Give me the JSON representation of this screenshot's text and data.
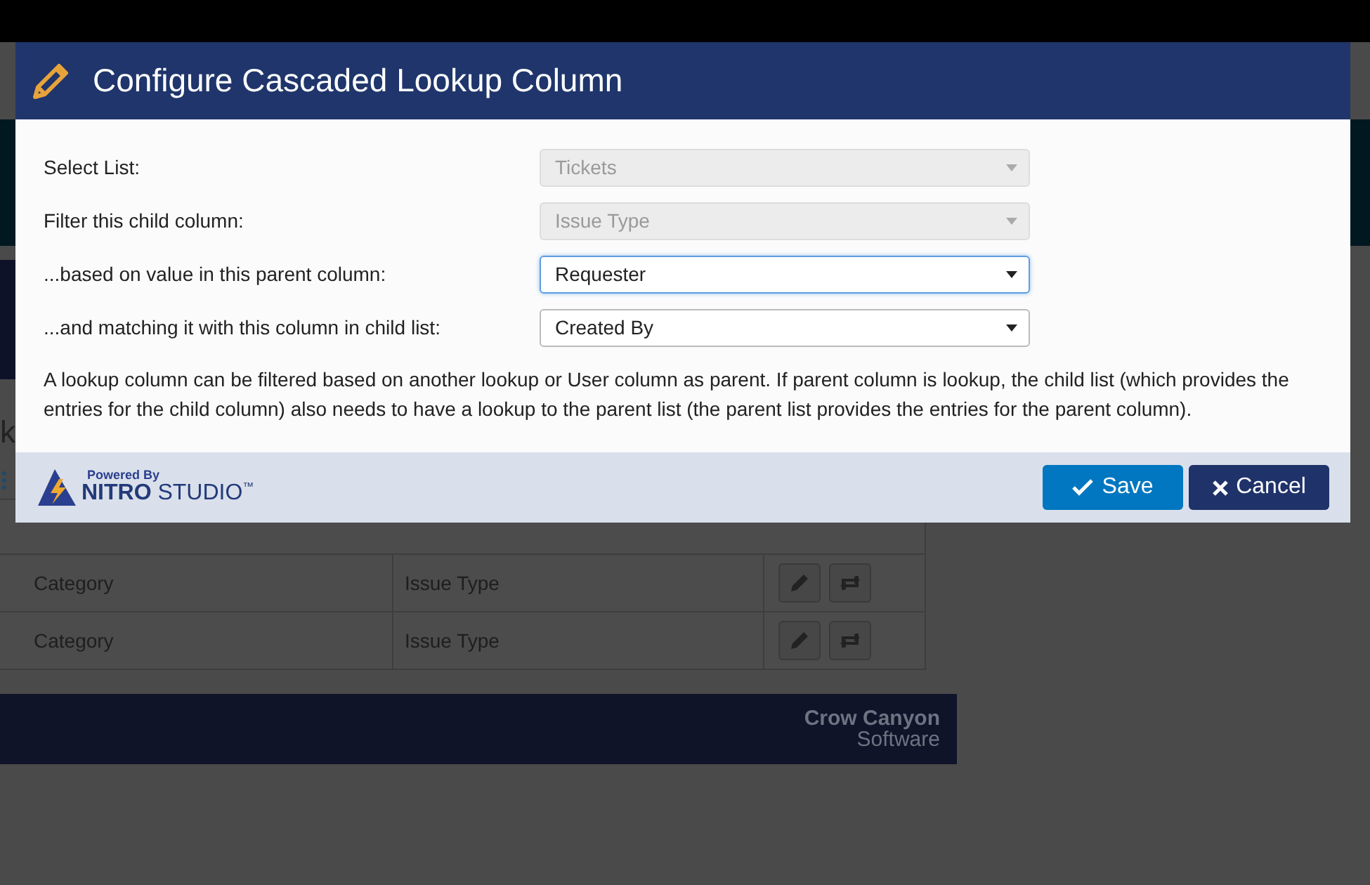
{
  "background": {
    "fragments": [
      "k"
    ],
    "table_rows": [
      {
        "column_1": "Category",
        "column_2": "Issue Type"
      },
      {
        "column_1": "Category",
        "column_2": "Issue Type"
      }
    ],
    "brand": {
      "name": "Crow Canyon",
      "sub": "Software"
    }
  },
  "dialog": {
    "title": "Configure Cascaded Lookup Column",
    "fields": [
      {
        "label": "Select List:",
        "value": "Tickets",
        "disabled": true,
        "focused": false
      },
      {
        "label": "Filter this child column:",
        "value": "Issue Type",
        "disabled": true,
        "focused": false
      },
      {
        "label": "...based on value in this parent column:",
        "value": "Requester",
        "disabled": false,
        "focused": true
      },
      {
        "label": "...and matching it with this column in child list:",
        "value": "Created By",
        "disabled": false,
        "focused": false
      }
    ],
    "note": "A lookup column can be filtered based on another lookup or User column as parent. If parent column is lookup, the child list (which provides the entries for the child column) also needs to have a lookup to the parent list (the parent list provides the entries for the parent column).",
    "footer_logo": {
      "tagline": "Powered By",
      "brand": "NITRO",
      "product": "STUDIO",
      "mark": "™"
    },
    "buttons": [
      {
        "label": "Save",
        "kind": "primary"
      },
      {
        "label": "Cancel",
        "kind": "secondary"
      }
    ]
  }
}
